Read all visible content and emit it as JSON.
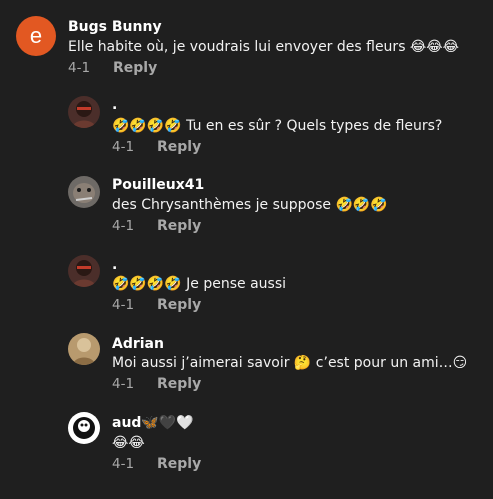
{
  "comments": [
    {
      "avatar_letter": "e",
      "name": "Bugs Bunny",
      "text": "Elle habite où, je voudrais lui envoyer des fleurs 😂😂😂",
      "date": "4-1",
      "reply": "Reply",
      "avatar_color": "#e25822"
    },
    {
      "name": ".",
      "text": "🤣🤣🤣🤣 Tu en es sûr ? Quels types de fleurs?",
      "date": "4-1",
      "reply": "Reply"
    },
    {
      "name": "Pouilleux41",
      "text": "des Chrysanthèmes je suppose 🤣🤣🤣",
      "date": "4-1",
      "reply": "Reply"
    },
    {
      "name": ".",
      "text": "🤣🤣🤣🤣 Je pense aussi",
      "date": "4-1",
      "reply": "Reply"
    },
    {
      "name": "Adrian",
      "text": "Moi aussi j’aimerai savoir 🤔 c’est pour un ami…😏",
      "date": "4-1",
      "reply": "Reply"
    },
    {
      "name": "aud🦋🖤🤍",
      "text": "😂😂",
      "date": "4-1",
      "reply": "Reply"
    }
  ]
}
